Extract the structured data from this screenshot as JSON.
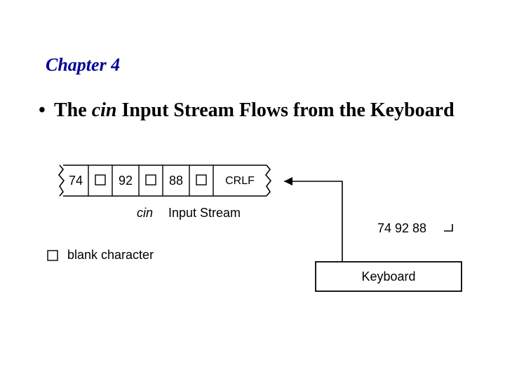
{
  "chapter": "Chapter 4",
  "bullet": {
    "pre": "The ",
    "cin": "cin",
    "post": " Input Stream Flows from the Keyboard"
  },
  "stream": {
    "cells": [
      "74",
      "",
      "92",
      "",
      "88",
      "",
      "CRLF"
    ],
    "label_cin": "cin",
    "label_stream": "Input Stream"
  },
  "legend": {
    "label": "blank character"
  },
  "keyboard": {
    "typed": "74 92 88",
    "label": "Keyboard"
  }
}
